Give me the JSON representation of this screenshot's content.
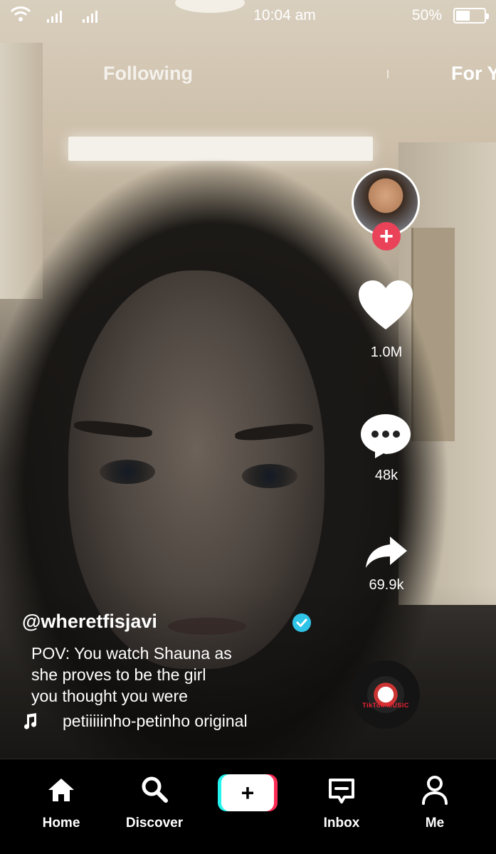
{
  "status_bar": {
    "time": "10:04 am",
    "battery_percent": "50%",
    "battery_level": 0.5
  },
  "top_tabs": {
    "following": "Following",
    "for_you": "For Y"
  },
  "video": {
    "likes": "1.0M",
    "comments": "48k",
    "shares": "69.9k",
    "username": "@wheretfisjavi",
    "caption_lines": [
      "POV: You watch Shauna as",
      "she proves to be the girl",
      "you thought you were"
    ],
    "sound": "petiiiiinho-petinho original",
    "disc_label": "TikTok MUSIC"
  },
  "bottom_nav": {
    "home": "Home",
    "discover": "Discover",
    "create": "+",
    "inbox": "Inbox",
    "me": "Me"
  },
  "colors": {
    "follow_plus": "#ea4259",
    "verified": "#2fc3e8",
    "create_cyan": "#25f4ee",
    "create_red": "#fe2c55"
  },
  "icons": [
    "wifi-icon",
    "signal-icon",
    "battery-icon",
    "heart-icon",
    "comment-icon",
    "share-icon",
    "music-note-icon",
    "verified-icon",
    "home-icon",
    "search-icon",
    "inbox-icon",
    "person-icon"
  ]
}
